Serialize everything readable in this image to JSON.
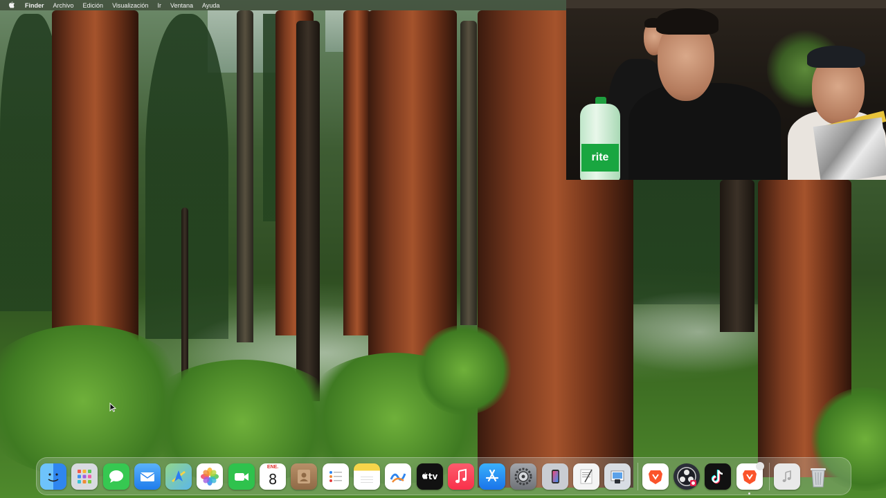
{
  "menubar": {
    "apple_icon": "apple-logo-icon",
    "items": [
      {
        "label": "Finder",
        "bold": true
      },
      {
        "label": "Archivo"
      },
      {
        "label": "Edición"
      },
      {
        "label": "Visualización"
      },
      {
        "label": "Ir"
      },
      {
        "label": "Ventana"
      },
      {
        "label": "Ayuda"
      }
    ]
  },
  "camera": {
    "bottle_label": "rite"
  },
  "dock": {
    "calendar": {
      "month": "ENE.",
      "day": "8"
    },
    "apps": [
      {
        "name": "Finder",
        "icon": "finder-icon",
        "color": "#3e9cf5",
        "running": true
      },
      {
        "name": "Launchpad",
        "icon": "launchpad-icon",
        "color": "#d9dbe0",
        "running": false
      },
      {
        "name": "Mensajes",
        "icon": "messages-icon",
        "color": "#36c851",
        "running": false
      },
      {
        "name": "Mail",
        "icon": "mail-icon",
        "color": "#2e8ff0",
        "running": false
      },
      {
        "name": "Mapas",
        "icon": "maps-icon",
        "color": "#6cc46a",
        "running": true
      },
      {
        "name": "Fotos",
        "icon": "photos-icon",
        "color": "#ffffff",
        "running": false
      },
      {
        "name": "FaceTime",
        "icon": "facetime-icon",
        "color": "#2fc24d",
        "running": false
      },
      {
        "name": "Calendario",
        "icon": "calendar-icon",
        "color": "#ffffff",
        "running": false
      },
      {
        "name": "Contactos",
        "icon": "contacts-icon",
        "color": "#a7825c",
        "running": false
      },
      {
        "name": "Recordatorios",
        "icon": "reminders-icon",
        "color": "#ffffff",
        "running": false
      },
      {
        "name": "Notas",
        "icon": "notes-icon",
        "color": "#f7e06a",
        "running": false
      },
      {
        "name": "Freeform",
        "icon": "freeform-icon",
        "color": "#ffffff",
        "running": false
      },
      {
        "name": "TV",
        "icon": "appletv-icon",
        "color": "#111111",
        "running": false
      },
      {
        "name": "Música",
        "icon": "music-icon",
        "color": "#fa3d55",
        "running": false
      },
      {
        "name": "App Store",
        "icon": "appstore-icon",
        "color": "#1d8cf4",
        "running": false
      },
      {
        "name": "Configuración",
        "icon": "settings-icon",
        "color": "#8a8d93",
        "running": false
      },
      {
        "name": "iPhone Mirroring",
        "icon": "iphone-mirroring-icon",
        "color": "#c9ccd2",
        "running": false
      },
      {
        "name": "TextEdit",
        "icon": "textedit-icon",
        "color": "#f4f4f4",
        "running": false
      },
      {
        "name": "Vista Previa",
        "icon": "preview-icon",
        "color": "#d8dde3",
        "running": false
      },
      {
        "name": "Brave",
        "icon": "brave-icon",
        "color": "#fb542b",
        "running": true
      },
      {
        "name": "OBS",
        "icon": "obs-icon",
        "color": "#2b2e38",
        "running": true
      },
      {
        "name": "TikTok",
        "icon": "tiktok-icon",
        "color": "#111111",
        "running": true
      },
      {
        "name": "Brave Beta",
        "icon": "brave-beta-icon",
        "color": "#fb542b",
        "running": true
      },
      {
        "name": "Música Descargada",
        "icon": "music-doc-icon",
        "color": "#e9e9e9",
        "running": false
      },
      {
        "name": "Papelera",
        "icon": "trash-icon",
        "color": "#cfd3d6",
        "running": false
      }
    ],
    "tv_label": "tv"
  }
}
